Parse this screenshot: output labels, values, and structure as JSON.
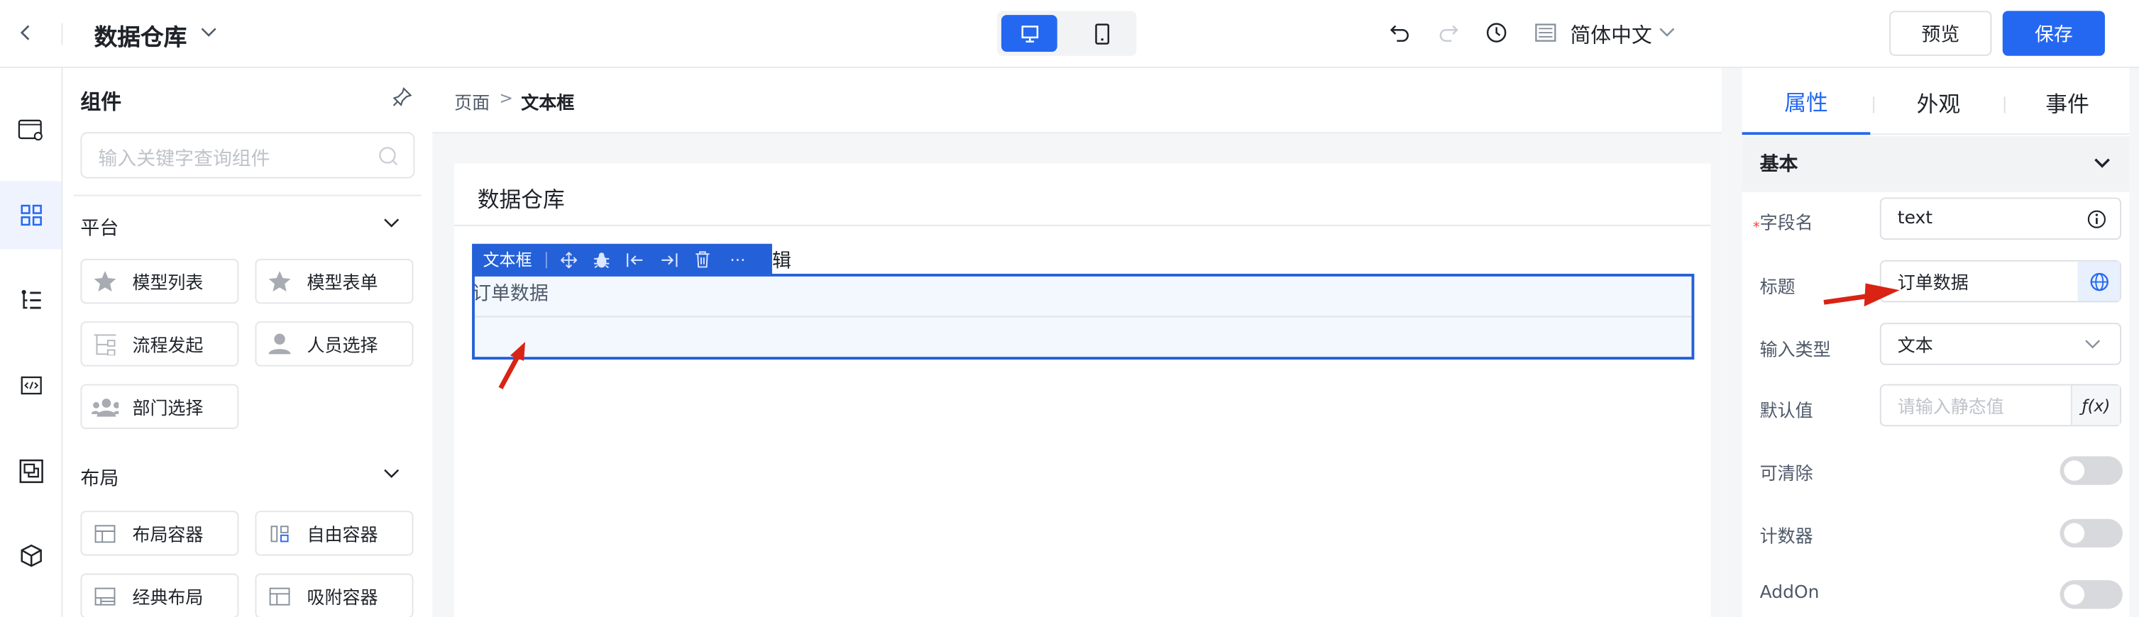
{
  "header": {
    "title": "数据仓库",
    "language": "简体中文",
    "preview_label": "预览",
    "save_label": "保存",
    "device_modes": [
      "desktop",
      "mobile"
    ],
    "active_device": "desktop"
  },
  "rail": {
    "items": [
      "page-settings-icon",
      "components-icon",
      "outline-tree-icon",
      "code-icon",
      "layers-icon",
      "package-icon"
    ],
    "active": "components-icon"
  },
  "components": {
    "title": "组件",
    "search_placeholder": "输入关键字查询组件",
    "groups": [
      {
        "name": "平台",
        "items": [
          "模型列表",
          "模型表单",
          "流程发起",
          "人员选择",
          "部门选择"
        ]
      },
      {
        "name": "布局",
        "items": [
          "布局容器",
          "自由容器",
          "经典布局",
          "吸附容器"
        ]
      }
    ]
  },
  "canvas": {
    "breadcrumb": [
      "页面",
      "文本框"
    ],
    "breadcrumb_separator": ">",
    "page_title": "数据仓库",
    "toolbar_label": "文本框",
    "behind_text": "辑",
    "field_label": "订单数据"
  },
  "props": {
    "tabs": [
      "属性",
      "外观",
      "事件"
    ],
    "active_tab": "属性",
    "section": "基本",
    "rows": {
      "field_name": {
        "label": "字段名",
        "value": "text",
        "required": true
      },
      "title": {
        "label": "标题",
        "value": "订单数据"
      },
      "input_type": {
        "label": "输入类型",
        "value": "文本"
      },
      "default": {
        "label": "默认值",
        "placeholder": "请输入静态值",
        "fx": "ƒ(x)"
      },
      "clearable": {
        "label": "可清除",
        "on": false
      },
      "counter": {
        "label": "计数器",
        "on": false
      },
      "addon": {
        "label": "AddOn",
        "on": false
      }
    }
  },
  "colors": {
    "accent": "#2468f2",
    "toolbar": "#2460d8",
    "annotation": "#d92314"
  }
}
